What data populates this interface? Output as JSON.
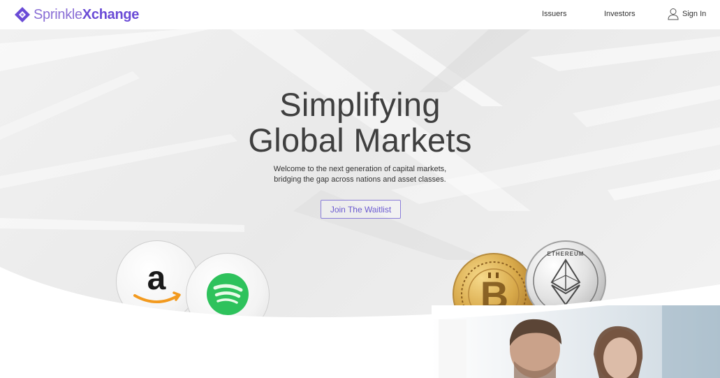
{
  "brand": {
    "name_light": "Sprinkle",
    "name_bold": "Xchange",
    "logo_color": "#6a4bd6"
  },
  "nav": {
    "issuers": "Issuers",
    "investors": "Investors",
    "signin": "Sign In",
    "signin_icon": "user-icon"
  },
  "hero": {
    "title_line1": "Simplifying",
    "title_line2": "Global Markets",
    "subtitle_line1": "Welcome to the next generation of capital markets,",
    "subtitle_line2": "bridging the gap across nations and asset classes.",
    "cta_label": "Join The Waitlist",
    "accent_color": "#6a5ad0"
  },
  "coins": {
    "amazon": "amazon-logo-icon",
    "spotify": "spotify-logo-icon",
    "bitcoin": "bitcoin-coin-icon",
    "ethereum": "ethereum-coin-icon",
    "ethereum_text": "ETHEREUM"
  },
  "photo": {
    "subject": "people-at-office-photo"
  }
}
